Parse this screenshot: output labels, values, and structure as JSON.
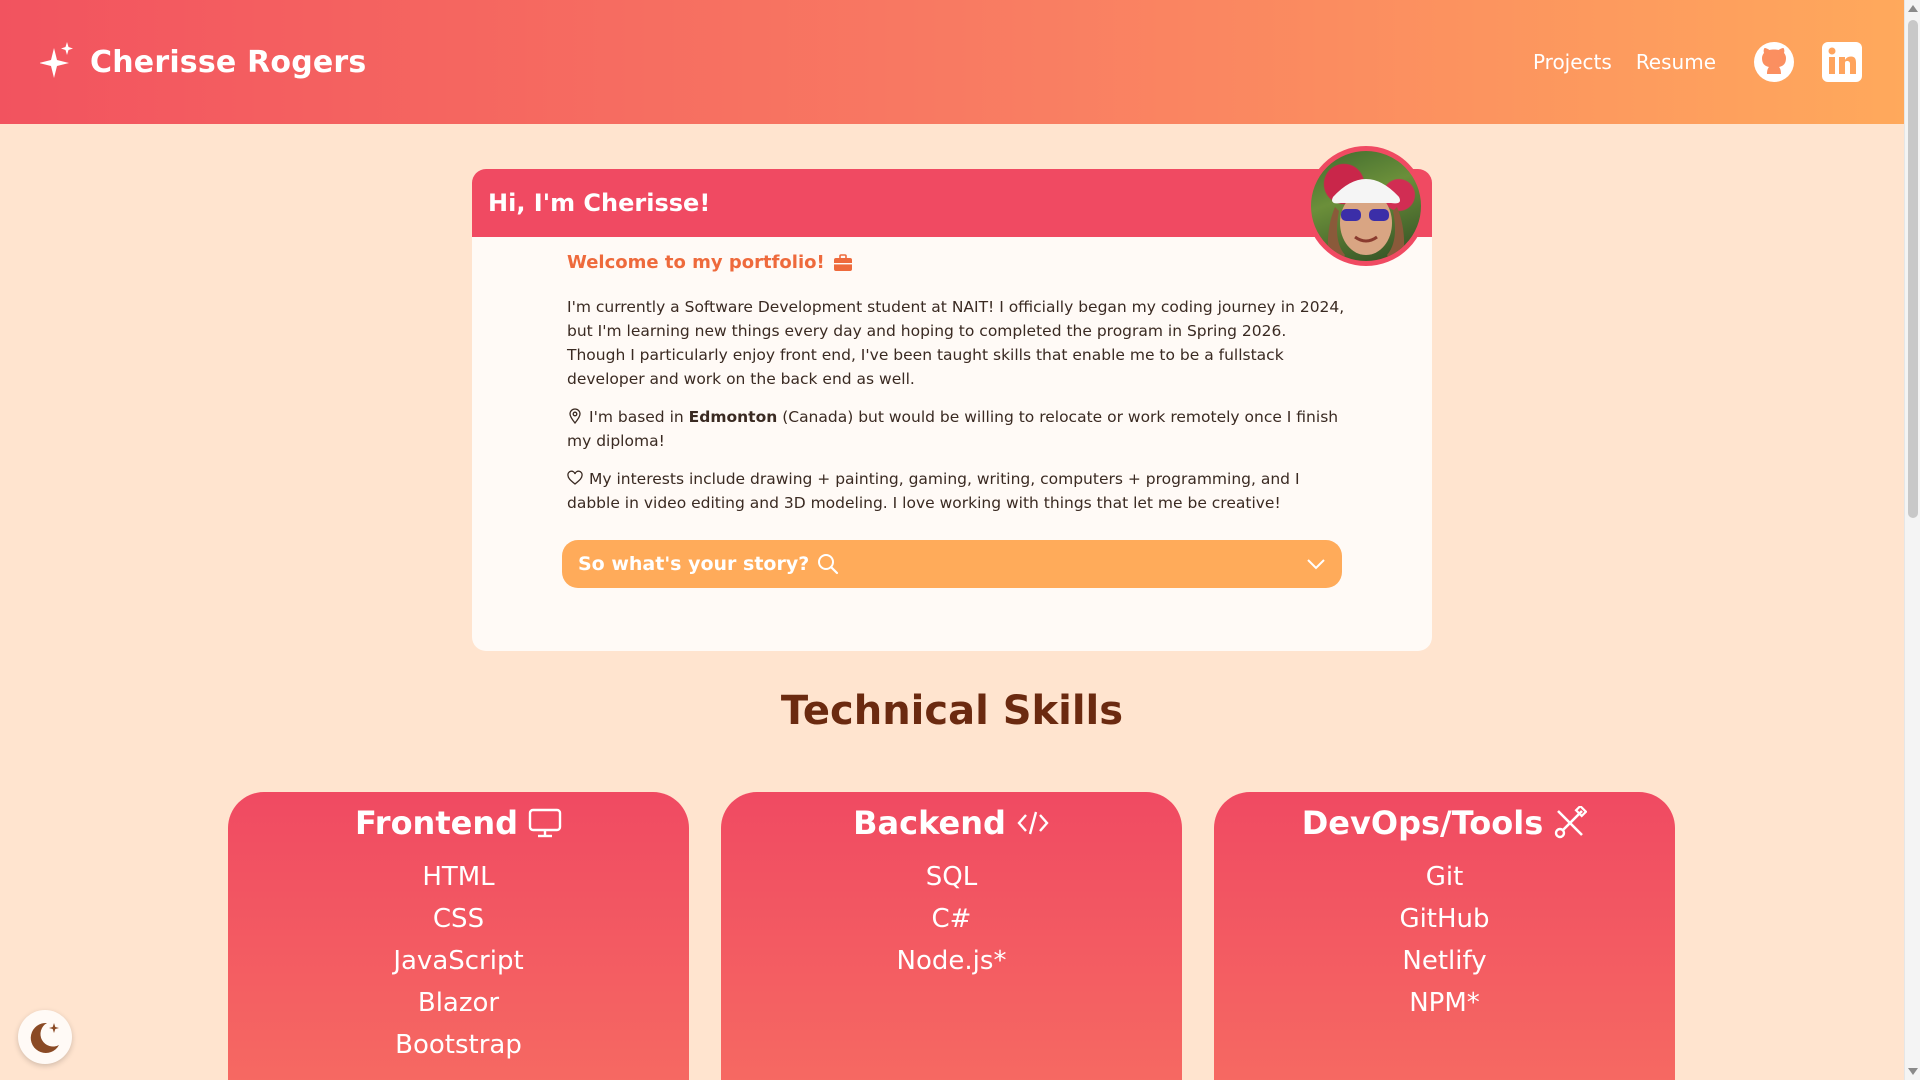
{
  "header": {
    "name": "Cherisse Rogers",
    "nav": [
      "Projects",
      "Resume"
    ]
  },
  "intro": {
    "greeting": "Hi, I'm Cherisse!",
    "welcome": "Welcome to my portfolio!",
    "p1": "I'm currently a Software Development student at NAIT! I officially began my coding journey in 2024, but I'm learning new things every day and hoping to completed the program in Spring 2026. Though I particularly enjoy front end, I've been taught skills that enable me to be a fullstack developer and work on the back end as well.",
    "p2_before": "I'm based in ",
    "p2_bold": "Edmonton",
    "p2_after": " (Canada) but would be willing to relocate or work remotely once I finish my diploma!",
    "p3": "My interests include drawing + painting, gaming, writing, computers + programming, and I dabble in video editing and 3D modeling. I love working with things that let me be creative!",
    "story_label": "So what's your story?"
  },
  "skills": {
    "title": "Technical Skills",
    "frontend": {
      "title": "Frontend",
      "items": [
        "HTML",
        "CSS",
        "JavaScript",
        "Blazor",
        "Bootstrap"
      ]
    },
    "backend": {
      "title": "Backend",
      "items": [
        "SQL",
        "C#",
        "Node.js*"
      ]
    },
    "devops": {
      "title": "DevOps/Tools",
      "items": [
        "Git",
        "GitHub",
        "Netlify",
        "NPM*"
      ]
    }
  },
  "colors": {
    "primary": "#f04a62",
    "accent": "#ffab5a",
    "background": "#ffe4cf",
    "heading": "#6b2a10"
  },
  "icons": {
    "brand": "sparkles-icon",
    "github": "github-icon",
    "linkedin": "linkedin-icon",
    "welcome": "briefcase-icon",
    "location": "map-pin-icon",
    "interests": "heart-icon",
    "story": "search-icon",
    "expand": "chevron-down-icon",
    "frontend": "monitor-icon",
    "backend": "code-icon",
    "devops": "tools-icon",
    "theme": "moon-stars-icon"
  }
}
